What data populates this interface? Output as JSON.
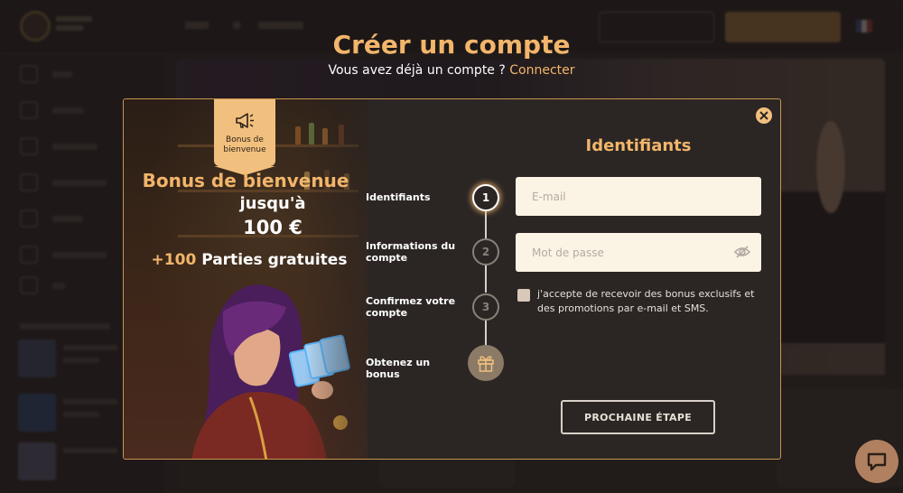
{
  "page": {
    "title": "Créer un compte",
    "have_account_text": "Vous avez déjà un compte ?",
    "login_link": "Connecter"
  },
  "promo": {
    "ribbon_label": "Bonus de bienvenue",
    "title": "Bonus de bienvenue",
    "up_to": "jusqu'à",
    "amount": "100 €",
    "spins_accent": "+100",
    "spins_text": "Parties gratuites"
  },
  "steps": [
    {
      "label": "Identifiants",
      "number": "1",
      "active": true
    },
    {
      "label": "Informations du compte",
      "number": "2",
      "active": false
    },
    {
      "label": "Confirmez votre compte",
      "number": "3",
      "active": false
    },
    {
      "label": "Obtenez un bonus",
      "icon": "gift-icon"
    }
  ],
  "form": {
    "title": "Identifiants",
    "email_placeholder": "E-mail",
    "password_placeholder": "Mot de passe",
    "consent_text": "j'accepte de recevoir des bonus exclusifs et des promotions par e-mail et SMS.",
    "consent_checked": false,
    "next_button": "PROCHAINE ÉTAPE"
  },
  "colors": {
    "accent": "#f2b56b",
    "modal_bg": "#2b2624",
    "field_bg": "#fbf3e4"
  },
  "icons": [
    "megaphone-icon",
    "close-icon",
    "eye-off-icon",
    "gift-icon",
    "chat-icon"
  ]
}
